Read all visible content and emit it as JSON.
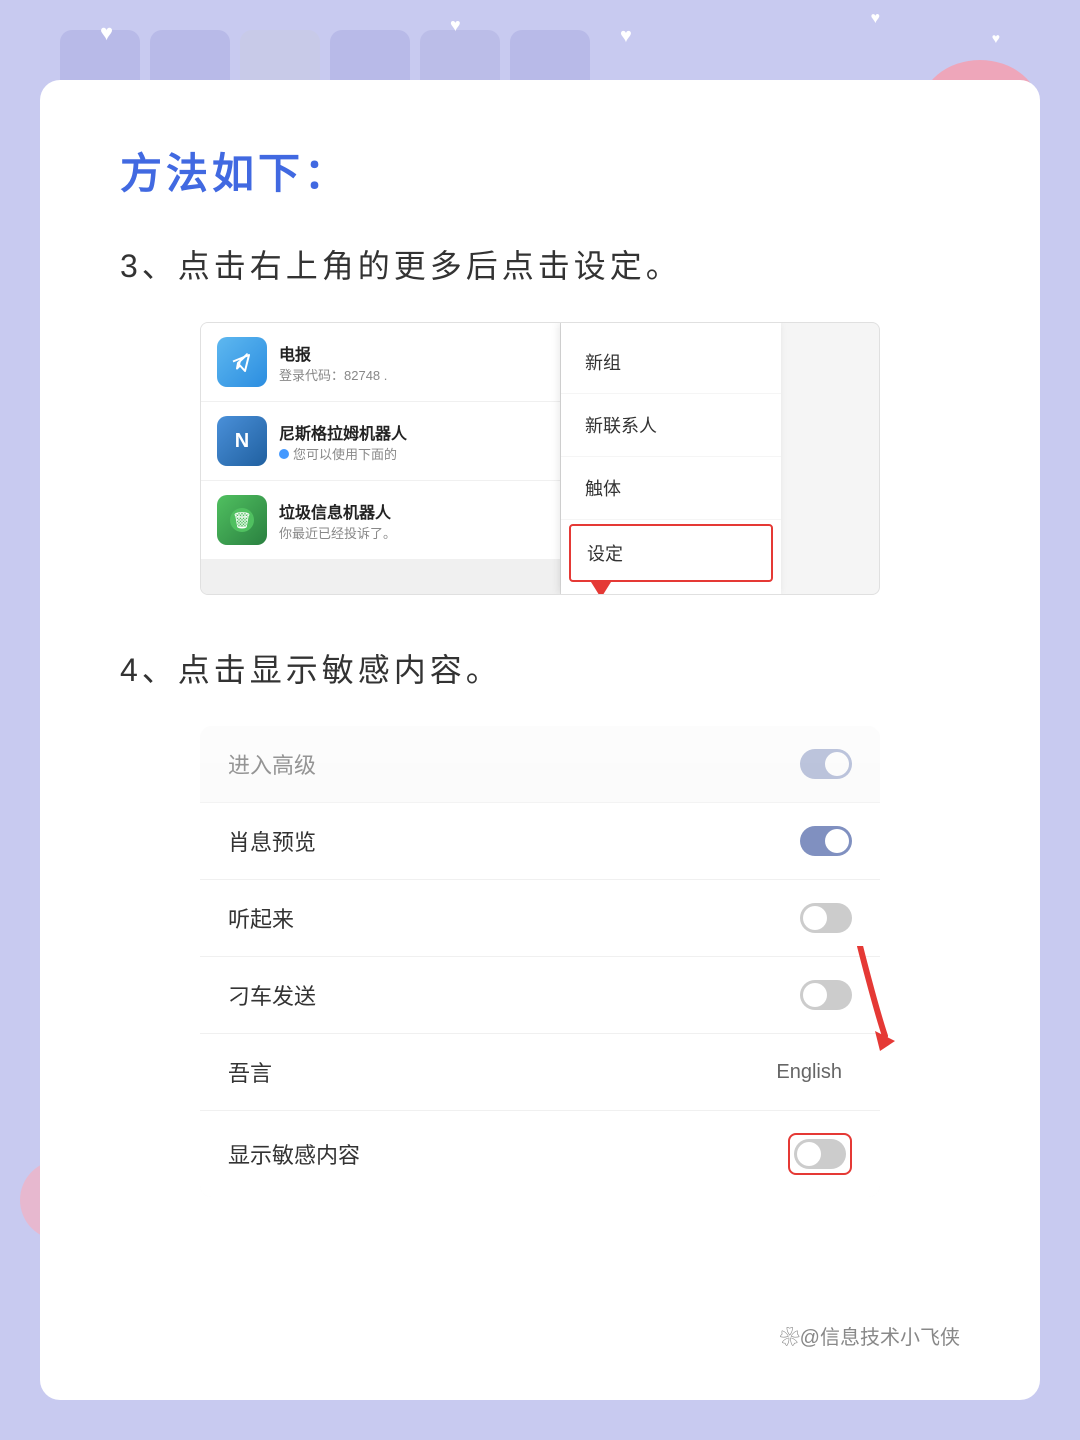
{
  "background_color": "#c8cae8",
  "page_bg": "#ffffff",
  "decorations": {
    "hearts": [
      "♥",
      "♥",
      "♥",
      "♥"
    ],
    "colors": [
      "#f9d85a",
      "#f4a0b0",
      "#f4b0c0",
      "#f9e07a"
    ]
  },
  "section_title": "方法如下：",
  "step3": {
    "text": "3、点击右上角的更多后点击设定。",
    "chat_items": [
      {
        "name": "电报",
        "desc": "登录代码：82748 .",
        "avatar_type": "telegram"
      },
      {
        "name": "尼斯格拉姆机器人",
        "desc": "●您可以使用下面的",
        "avatar_type": "nisge",
        "avatar_letter": "N"
      },
      {
        "name": "垃圾信息机器人",
        "desc": "你最近已经投诉了。",
        "avatar_type": "trash"
      }
    ],
    "menu_items": [
      {
        "label": "新组",
        "highlighted": false
      },
      {
        "label": "新联系人",
        "highlighted": false
      },
      {
        "label": "触体",
        "highlighted": false
      },
      {
        "label": "设定",
        "highlighted": true
      }
    ]
  },
  "step4": {
    "text": "4、点击显示敏感内容。",
    "settings_rows": [
      {
        "label": "进入高级",
        "value_type": "toggle",
        "toggle_state": "on",
        "dimmed": true
      },
      {
        "label": "肖息预览",
        "value_type": "toggle",
        "toggle_state": "on"
      },
      {
        "label": "听起来",
        "value_type": "toggle",
        "toggle_state": "off"
      },
      {
        "label": "刁车发送",
        "value_type": "toggle",
        "toggle_state": "off"
      },
      {
        "label": "吾言",
        "value_type": "lang",
        "lang_value": "English"
      },
      {
        "label": "显示敏感内容",
        "value_type": "toggle",
        "toggle_state": "off",
        "highlighted": true
      }
    ]
  },
  "watermark": "❀@信息技术小飞侠"
}
